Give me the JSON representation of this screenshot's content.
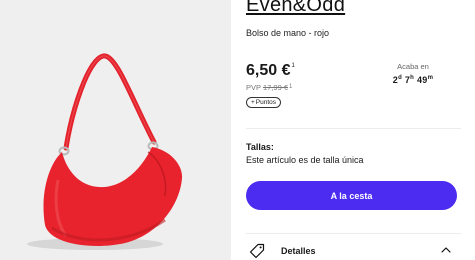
{
  "brand": "Even&Odd",
  "product": {
    "name": "Bolso de mano - rojo",
    "price": "6,50 €",
    "price_note": "1",
    "pvp_label": "PVP",
    "pvp_price": "17,99 €",
    "pvp_note": "1",
    "points_label": "Puntos",
    "points_icon": "plus-icon",
    "image_colors": {
      "background": "#efefef",
      "bag": "#e8232d"
    }
  },
  "sale": {
    "ends_label": "Acaba en",
    "days": "2",
    "days_unit": "d",
    "hours": "7",
    "hours_unit": "h",
    "minutes": "49",
    "minutes_unit": "m"
  },
  "sizes": {
    "title": "Tallas:",
    "text": "Este artículo es de talla única"
  },
  "cart": {
    "label": "A la cesta",
    "color": "#4b2cf0"
  },
  "details": {
    "label": "Detalles",
    "icon": "tag-icon",
    "chevron": "chevron-up-icon"
  }
}
